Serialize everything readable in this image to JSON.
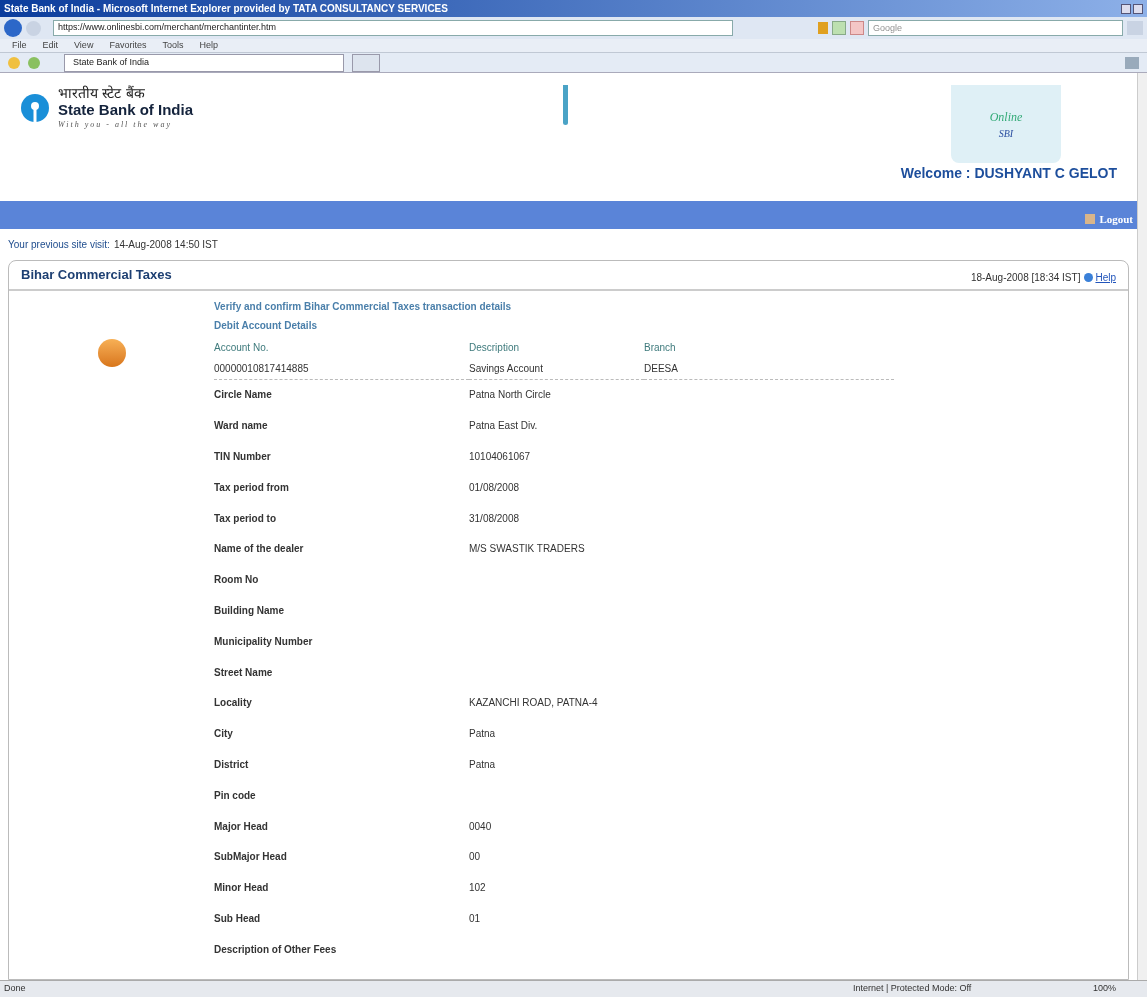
{
  "window": {
    "title": "State Bank of India - Microsoft Internet Explorer provided by TATA CONSULTANCY SERVICES"
  },
  "address_bar": {
    "url": "https://www.onlinesbi.com/merchant/merchantinter.htm",
    "search_placeholder": "Google"
  },
  "menu": [
    "File",
    "Edit",
    "View",
    "Favorites",
    "Tools",
    "Help"
  ],
  "tab": {
    "label": "State Bank of India"
  },
  "header": {
    "hindi_name": "भारतीय स्टेट बैंक",
    "bank_name": "State Bank of India",
    "tagline": "With you - all the way",
    "logo_text": "Online",
    "logo_sub": "SBI",
    "welcome": "Welcome : DUSHYANT C GELOT",
    "logout": "Logout"
  },
  "previous_visit": {
    "label": "Your previous site visit:",
    "value": "14-Aug-2008 14:50 IST"
  },
  "panel": {
    "title": "Bihar Commercial Taxes",
    "datetime": "18-Aug-2008 [18:34 IST]",
    "help": "Help",
    "instruction": "Verify and confirm Bihar Commercial Taxes transaction details",
    "section": "Debit Account Details",
    "account_columns": [
      "Account No.",
      "Description",
      "Branch"
    ],
    "account_row": [
      "00000010817414885",
      "Savings Account",
      "DEESA"
    ],
    "fields": [
      {
        "label": "Circle Name",
        "value": "Patna North Circle"
      },
      {
        "label": "Ward name",
        "value": "Patna East Div."
      },
      {
        "label": "TIN Number",
        "value": "10104061067"
      },
      {
        "label": "Tax period from",
        "value": "01/08/2008"
      },
      {
        "label": "Tax period to",
        "value": "31/08/2008"
      },
      {
        "label": "Name of the dealer",
        "value": "M/S SWASTIK TRADERS"
      },
      {
        "label": "Room No"
      },
      {
        "label": "Building Name"
      },
      {
        "label": "Municipality Number"
      },
      {
        "label": "Street Name"
      },
      {
        "label": "Locality",
        "value": "KAZANCHI ROAD, PATNA-4"
      },
      {
        "label": "City",
        "value": "Patna"
      },
      {
        "label": "District",
        "value": "Patna"
      },
      {
        "label": "Pin code"
      },
      {
        "label": "Major Head",
        "value": "0040"
      },
      {
        "label": "SubMajor Head",
        "value": "00"
      },
      {
        "label": "Minor Head",
        "value": "102"
      },
      {
        "label": "Sub Head",
        "value": "01"
      },
      {
        "label": "Description of Other Fees"
      }
    ]
  },
  "status_bar": {
    "left": "Done",
    "zone": "Internet | Protected Mode: Off",
    "zoom": "100%"
  }
}
